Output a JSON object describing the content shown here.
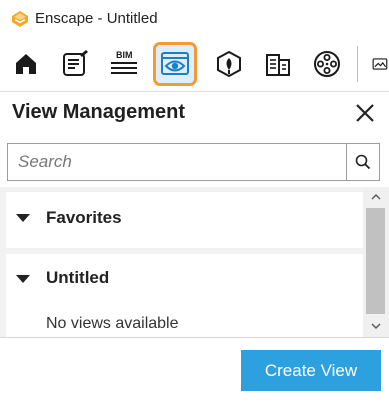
{
  "window": {
    "title": "Enscape - Untitled",
    "app_icon": "enscape-logo-icon"
  },
  "toolbar": {
    "bim_label": "BIM",
    "items": [
      {
        "icon": "home-icon",
        "active": false
      },
      {
        "icon": "notes-icon",
        "active": false
      },
      {
        "icon": "bim-icon",
        "active": false
      },
      {
        "icon": "view-management-icon",
        "active": true
      },
      {
        "icon": "asset-library-icon",
        "active": false
      },
      {
        "icon": "building-icon",
        "active": false
      },
      {
        "icon": "video-icon",
        "active": false
      },
      {
        "icon": "screenshot-icon",
        "active": false
      }
    ],
    "active_color": "#f39a35"
  },
  "panel": {
    "title": "View Management",
    "close_icon": "close-icon"
  },
  "search": {
    "placeholder": "Search",
    "value": "",
    "icon": "search-icon"
  },
  "groups": [
    {
      "label": "Favorites",
      "expanded": true,
      "empty_text": ""
    },
    {
      "label": "Untitled",
      "expanded": true,
      "empty_text": "No views available"
    }
  ],
  "actions": {
    "create_view_label": "Create View",
    "accent_color": "#2da1e0"
  }
}
